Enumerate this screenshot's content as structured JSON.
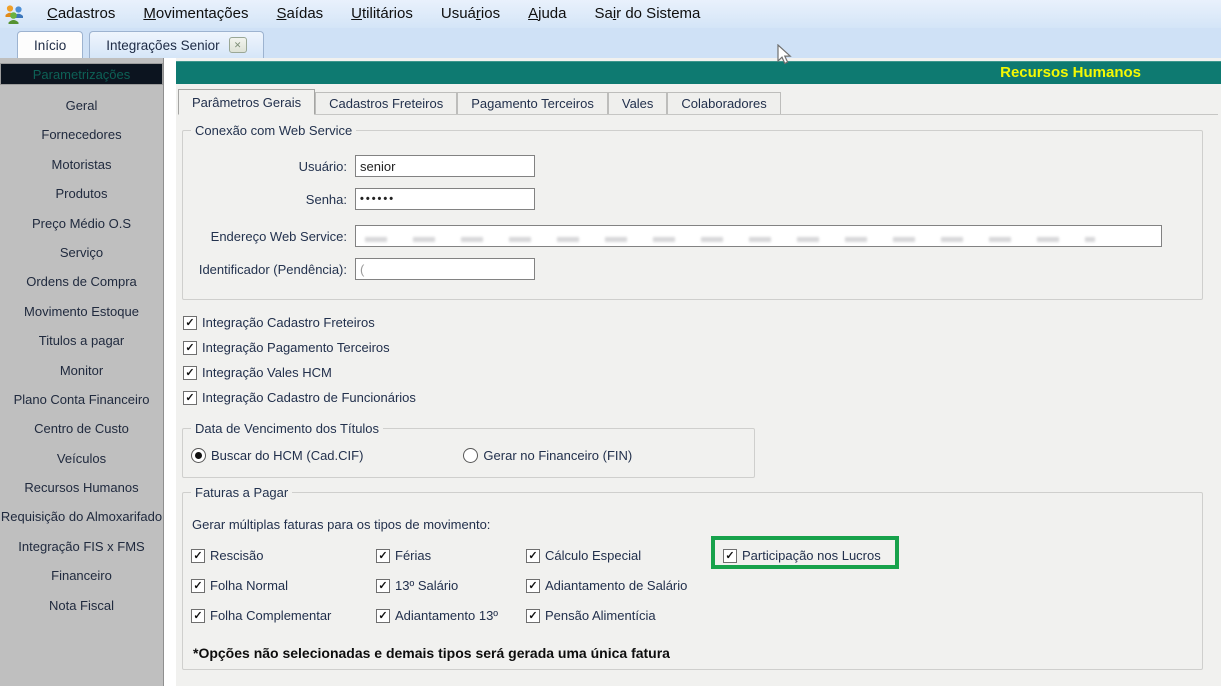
{
  "menu": {
    "items": [
      {
        "pre": "",
        "key": "C",
        "post": "adastros"
      },
      {
        "pre": "",
        "key": "M",
        "post": "ovimentações"
      },
      {
        "pre": "",
        "key": "S",
        "post": "aídas"
      },
      {
        "pre": "",
        "key": "U",
        "post": "tilitários"
      },
      {
        "pre": "Usuá",
        "key": "r",
        "post": "ios"
      },
      {
        "pre": "",
        "key": "A",
        "post": "juda"
      },
      {
        "pre": "Sa",
        "key": "i",
        "post": "r do Sistema"
      }
    ]
  },
  "window_tabs": {
    "inicio": "Início",
    "integracoes_senior": "Integrações Senior",
    "close_glyph": "✕"
  },
  "header": {
    "title": "Recursos Humanos"
  },
  "sidebar": {
    "selected": "Parametrizações",
    "items": [
      "Geral",
      "Fornecedores",
      "Motoristas",
      "Produtos",
      "Preço Médio O.S",
      "Serviço",
      "Ordens de Compra",
      "Movimento Estoque",
      "Titulos a pagar",
      "Monitor",
      "Plano Conta Financeiro",
      "Centro de Custo",
      "Veículos",
      "Recursos Humanos",
      "Requisição do Almoxarifado",
      "Integração FIS x FMS",
      "Financeiro",
      "Nota Fiscal"
    ]
  },
  "content": {
    "tabs": [
      "Parâmetros Gerais",
      "Cadastros Freteiros",
      "Pagamento Terceiros",
      "Vales",
      "Colaboradores"
    ],
    "connection_group": {
      "title": "Conexão com Web Service",
      "fields": [
        {
          "label": "Usuário:",
          "value": "senior"
        },
        {
          "label": "Senha:",
          "value": "••••••"
        },
        {
          "label": "Endereço Web Service:",
          "value": ""
        },
        {
          "label": "Identificador (Pendência):",
          "value": "("
        }
      ]
    },
    "integrations": [
      {
        "label": "Integração Cadastro Freteiros",
        "checked": true
      },
      {
        "label": "Integração Pagamento Terceiros",
        "checked": true
      },
      {
        "label": "Integração Vales HCM",
        "checked": true
      },
      {
        "label": "Integração Cadastro de Funcionários",
        "checked": true
      }
    ],
    "due_date_group": {
      "title": "Data de Vencimento dos Títulos",
      "options": [
        {
          "label": "Buscar do HCM (Cad.CIF)",
          "selected": true
        },
        {
          "label": "Gerar no Financeiro (FIN)",
          "selected": false
        }
      ]
    },
    "invoices_group": {
      "title": "Faturas a Pagar",
      "subtitle": "Gerar múltiplas faturas para os tipos de movimento:",
      "rows": [
        [
          {
            "label": "Rescisão",
            "checked": true
          },
          {
            "label": "Férias",
            "checked": true
          },
          {
            "label": "Cálculo Especial",
            "checked": true
          },
          {
            "label": "Participação nos Lucros",
            "checked": true,
            "highlighted": true
          }
        ],
        [
          {
            "label": "Folha Normal",
            "checked": true
          },
          {
            "label": "13º Salário",
            "checked": true
          },
          {
            "label": "Adiantamento de Salário",
            "checked": true
          }
        ],
        [
          {
            "label": "Folha Complementar",
            "checked": true
          },
          {
            "label": "Adiantamento 13º",
            "checked": true
          },
          {
            "label": "Pensão Alimentícia",
            "checked": true
          }
        ]
      ],
      "note": "*Opções não selecionadas e demais tipos será gerada uma única fatura"
    },
    "check_glyph": "✓"
  },
  "colors": {
    "teal_bar": "#0e7a71",
    "header_text": "#f5f903",
    "highlight_green": "#17a24b",
    "sidebar_gray": "#bfbfbf",
    "selected_item_bg": "#0c141f"
  }
}
